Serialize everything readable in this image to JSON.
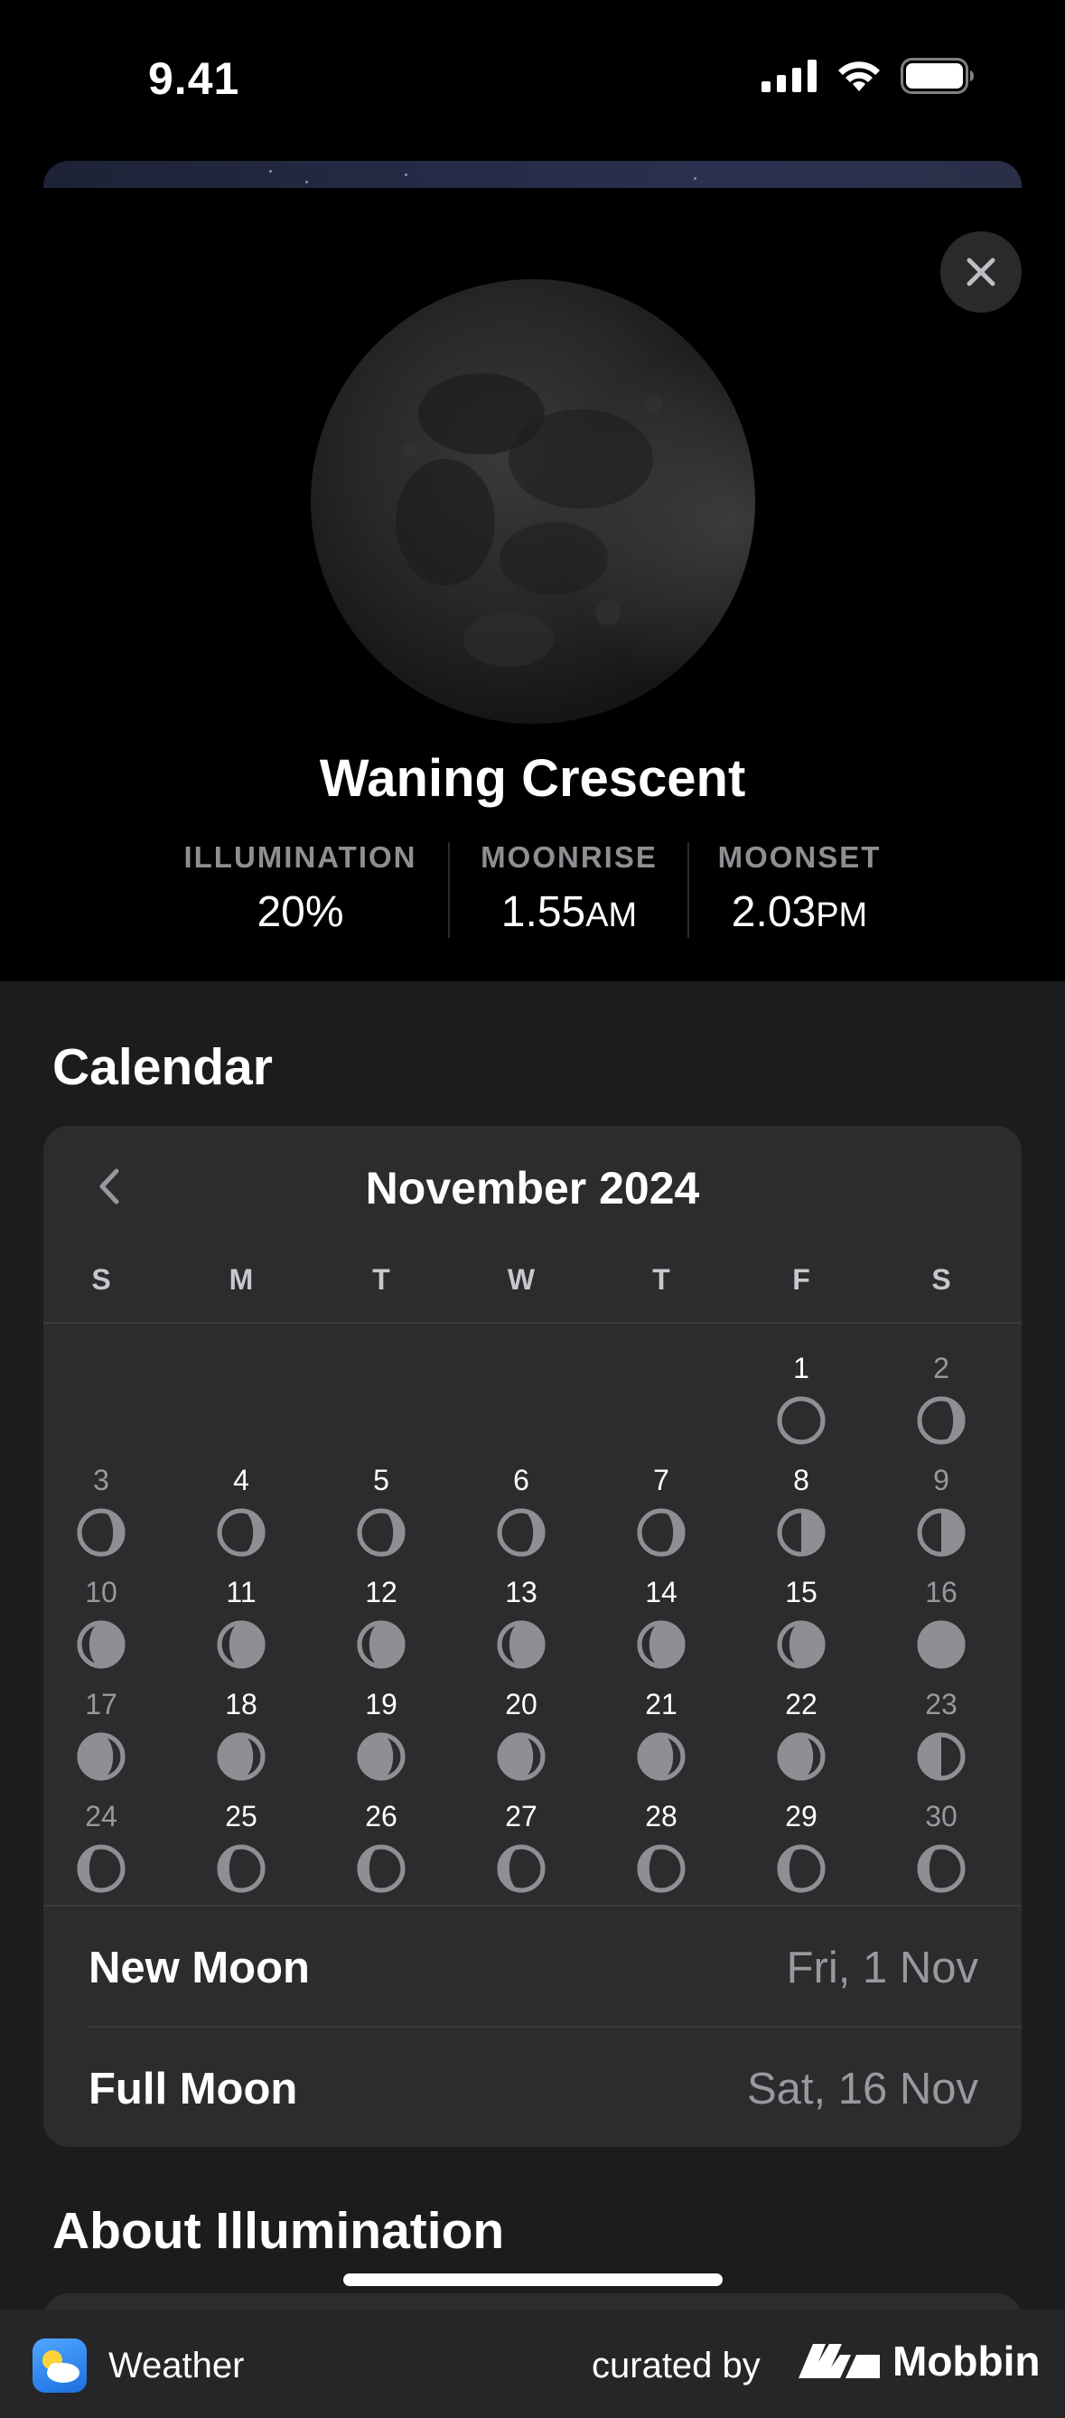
{
  "status_bar": {
    "time": "9.41"
  },
  "moon": {
    "phase_name": "Waning Crescent",
    "stats": [
      {
        "label": "ILLUMINATION",
        "value": "20%",
        "suffix": ""
      },
      {
        "label": "MOONRISE",
        "value": "1.55",
        "suffix": "AM"
      },
      {
        "label": "MOONSET",
        "value": "2.03",
        "suffix": "PM"
      }
    ]
  },
  "calendar": {
    "section_title": "Calendar",
    "month_label": "November 2024",
    "weekdays": [
      "S",
      "M",
      "T",
      "W",
      "T",
      "F",
      "S"
    ],
    "days": [
      {
        "d": "1",
        "phase": "new"
      },
      {
        "d": "2",
        "phase": "waxing-crescent"
      },
      {
        "d": "3",
        "phase": "waxing-crescent"
      },
      {
        "d": "4",
        "phase": "waxing-crescent"
      },
      {
        "d": "5",
        "phase": "waxing-crescent"
      },
      {
        "d": "6",
        "phase": "waxing-crescent"
      },
      {
        "d": "7",
        "phase": "waxing-crescent"
      },
      {
        "d": "8",
        "phase": "first-quarter"
      },
      {
        "d": "9",
        "phase": "first-quarter"
      },
      {
        "d": "10",
        "phase": "waxing-gibbous"
      },
      {
        "d": "11",
        "phase": "waxing-gibbous"
      },
      {
        "d": "12",
        "phase": "waxing-gibbous"
      },
      {
        "d": "13",
        "phase": "waxing-gibbous"
      },
      {
        "d": "14",
        "phase": "waxing-gibbous"
      },
      {
        "d": "15",
        "phase": "waxing-gibbous"
      },
      {
        "d": "16",
        "phase": "full"
      },
      {
        "d": "17",
        "phase": "waning-gibbous"
      },
      {
        "d": "18",
        "phase": "waning-gibbous"
      },
      {
        "d": "19",
        "phase": "waning-gibbous"
      },
      {
        "d": "20",
        "phase": "waning-gibbous"
      },
      {
        "d": "21",
        "phase": "waning-gibbous"
      },
      {
        "d": "22",
        "phase": "waning-gibbous"
      },
      {
        "d": "23",
        "phase": "last-quarter"
      },
      {
        "d": "24",
        "phase": "waning-crescent"
      },
      {
        "d": "25",
        "phase": "waning-crescent"
      },
      {
        "d": "26",
        "phase": "waning-crescent"
      },
      {
        "d": "27",
        "phase": "waning-crescent"
      },
      {
        "d": "28",
        "phase": "waning-crescent"
      },
      {
        "d": "29",
        "phase": "waning-crescent"
      },
      {
        "d": "30",
        "phase": "waning-crescent"
      }
    ],
    "events": [
      {
        "name": "New Moon",
        "date": "Fri, 1 Nov"
      },
      {
        "name": "Full Moon",
        "date": "Sat, 16 Nov"
      }
    ]
  },
  "about": {
    "section_title": "About Illumination"
  },
  "footer": {
    "app_name": "Weather",
    "curated_by": "curated by",
    "brand": "Mobbin"
  },
  "colors": {
    "background": "#000000",
    "panel": "#1c1c1e",
    "card": "#2c2c2e",
    "muted": "#98989d",
    "phase_light": "#8e8e93"
  }
}
